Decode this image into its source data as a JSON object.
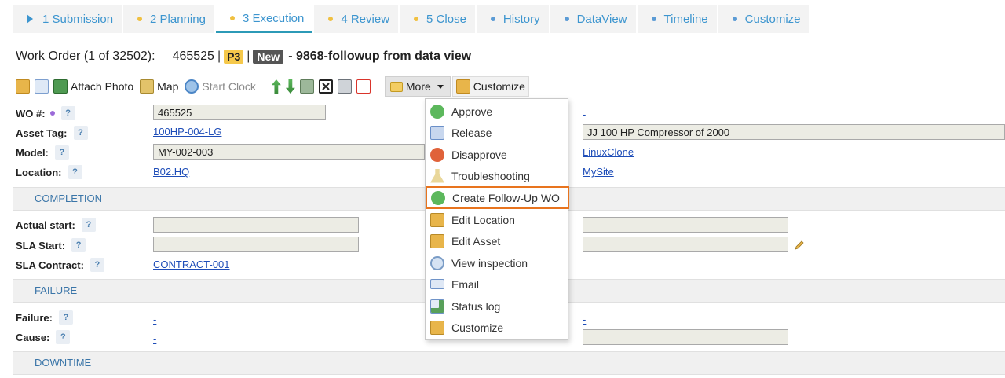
{
  "tabs": [
    {
      "label": "1 Submission",
      "marker": "triangle",
      "color": "#3c95cf"
    },
    {
      "label": "2 Planning",
      "marker": "dot",
      "color": "#f0c040"
    },
    {
      "label": "3 Execution",
      "marker": "dot",
      "color": "#f0c040",
      "active": true
    },
    {
      "label": "4 Review",
      "marker": "dot",
      "color": "#f0c040"
    },
    {
      "label": "5 Close",
      "marker": "dot",
      "color": "#f0c040"
    },
    {
      "label": "History",
      "marker": "dot",
      "color": "#5b9bd5"
    },
    {
      "label": "DataView",
      "marker": "dot",
      "color": "#5b9bd5"
    },
    {
      "label": "Timeline",
      "marker": "dot",
      "color": "#5b9bd5"
    },
    {
      "label": "Customize",
      "marker": "dot",
      "color": "#5b9bd5"
    }
  ],
  "title": {
    "prefix": "Work Order (1 of 32502):",
    "wo_number": "465525",
    "sep1": "|",
    "priority": "P3",
    "sep2": "|",
    "status": "New",
    "description": "- 9868-followup from data view"
  },
  "toolbar": {
    "attach_photo": "Attach Photo",
    "map": "Map",
    "start_clock": "Start Clock",
    "more": "More",
    "customize": "Customize"
  },
  "fields": {
    "wo": {
      "label": "WO #:",
      "help": "?",
      "value": "465525"
    },
    "asset_tag": {
      "label": "Asset Tag:",
      "help": "?",
      "value": "100HP-004-LG"
    },
    "model": {
      "label": "Model:",
      "help": "?",
      "value": "MY-002-003"
    },
    "location": {
      "label": "Location:",
      "help": "?",
      "value": "B02.HQ"
    },
    "right_link_top": "-",
    "asset_desc": "JJ 100 HP Compressor of 2000",
    "linux_clone": "LinuxClone",
    "my_site": "MySite"
  },
  "completion": {
    "header": "COMPLETION",
    "actual_start": {
      "label": "Actual start:",
      "help": "?",
      "value": ""
    },
    "sla_start": {
      "label": "SLA Start:",
      "help": "?",
      "value": ""
    },
    "sla_contract": {
      "label": "SLA Contract:",
      "help": "?",
      "value": "CONTRACT-001"
    }
  },
  "failure": {
    "header": "FAILURE",
    "failure": {
      "label": "Failure:",
      "help": "?",
      "value": "-"
    },
    "cause": {
      "label": "Cause:",
      "help": "?",
      "value": "-"
    },
    "right_link": "-"
  },
  "downtime": {
    "header": "DOWNTIME"
  },
  "menu": {
    "items": [
      {
        "label": "Approve",
        "icon": "check-circle-icon",
        "color": "#5cb85c"
      },
      {
        "label": "Release",
        "icon": "document-plus-icon",
        "color": "#6a8fc8"
      },
      {
        "label": "Disapprove",
        "icon": "exclamation-circle-icon",
        "color": "#e0623a"
      },
      {
        "label": "Troubleshooting",
        "icon": "flask-icon",
        "color": "#c9a94a"
      },
      {
        "label": "Create Follow-Up WO",
        "icon": "plus-circle-icon",
        "color": "#5cb85c",
        "highlighted": true
      },
      {
        "label": "Edit Location",
        "icon": "edit-form-icon",
        "color": "#e8a93a"
      },
      {
        "label": "Edit Asset",
        "icon": "edit-form-icon",
        "color": "#e8a93a"
      },
      {
        "label": "View inspection",
        "icon": "magnifier-icon",
        "color": "#7a9cc6"
      },
      {
        "label": "Email",
        "icon": "envelope-icon",
        "color": "#6f93c8"
      },
      {
        "label": "Status log",
        "icon": "status-log-icon",
        "color": "#58a05a"
      },
      {
        "label": "Customize",
        "icon": "customize-icon",
        "color": "#e8a93a"
      }
    ]
  }
}
